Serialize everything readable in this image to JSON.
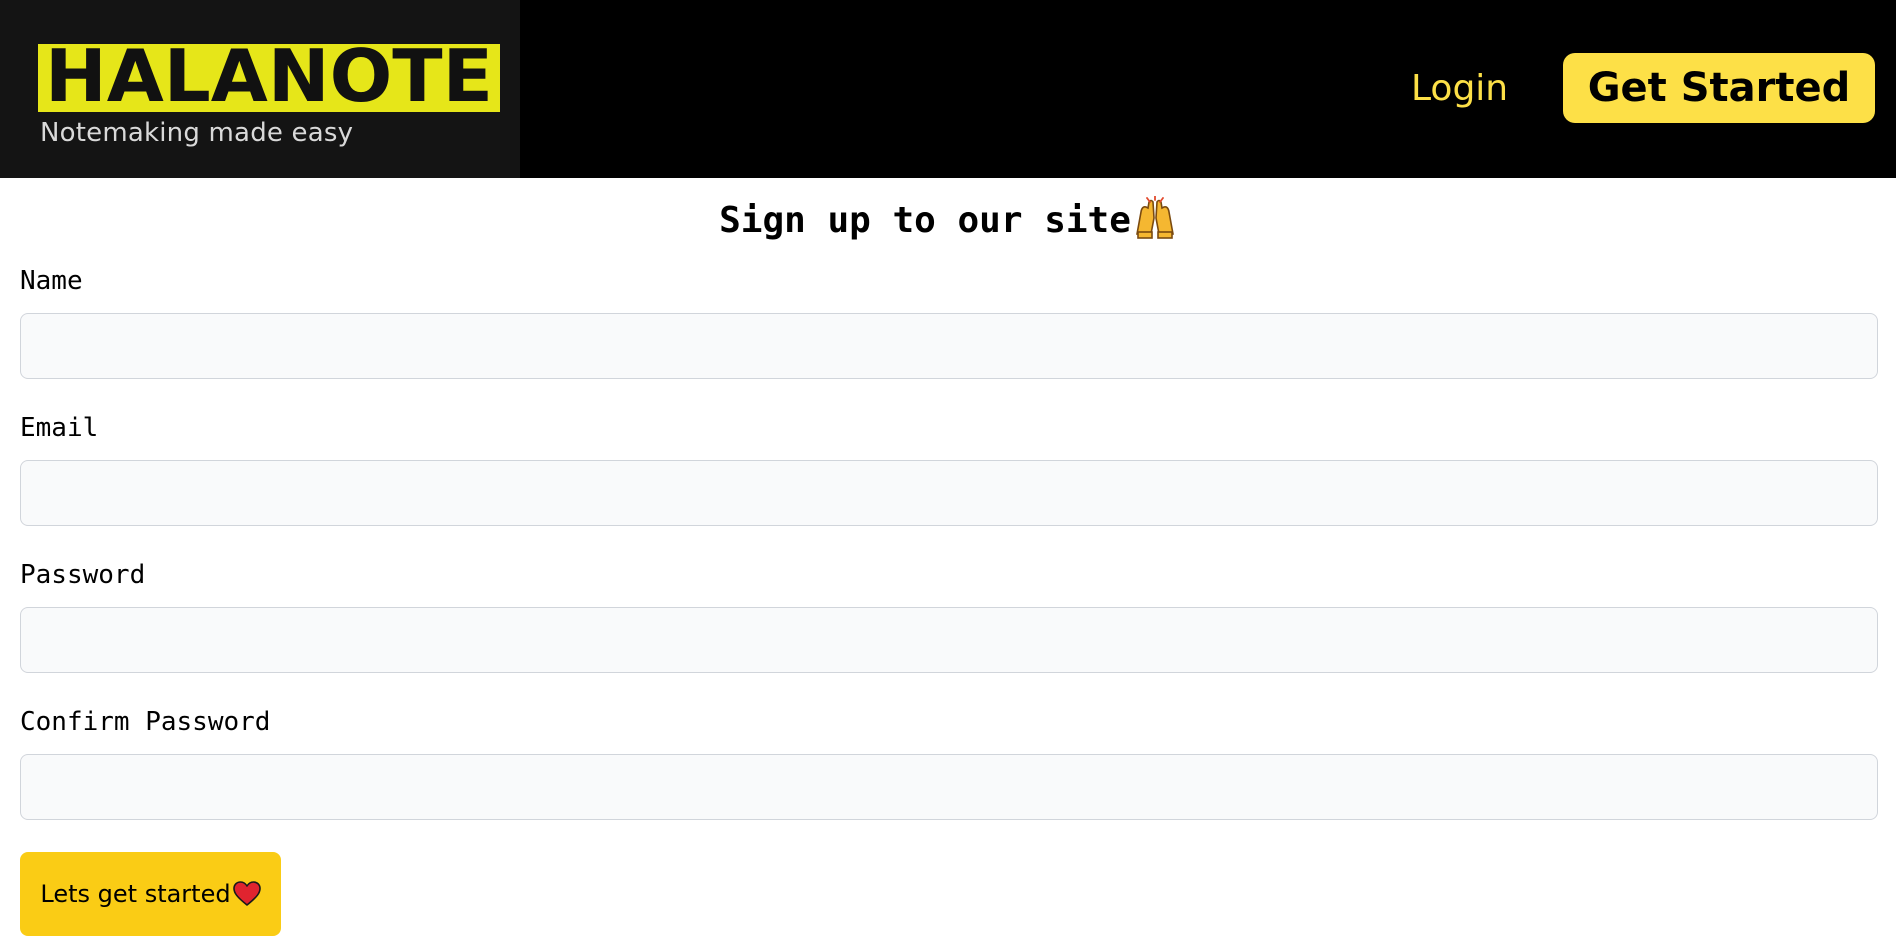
{
  "header": {
    "logo_text": "HALANOTE",
    "tagline": "Notemaking made easy",
    "login_label": "Login",
    "get_started_label": "Get Started"
  },
  "form": {
    "title": "Sign up to our site",
    "title_icon": "raising-hands-icon",
    "fields": [
      {
        "label": "Name",
        "value": "",
        "placeholder": ""
      },
      {
        "label": "Email",
        "value": "",
        "placeholder": ""
      },
      {
        "label": "Password",
        "value": "",
        "placeholder": ""
      },
      {
        "label": "Confirm Password",
        "value": "",
        "placeholder": ""
      }
    ],
    "submit_label": "Lets get started",
    "submit_icon": "heart-icon"
  },
  "colors": {
    "navbar_bg": "#000000",
    "logo_bg": "#141414",
    "brand_yellow": "#fde047",
    "submit_yellow": "#facc15",
    "input_bg": "#f9fafb",
    "input_border": "#d1d5db"
  }
}
